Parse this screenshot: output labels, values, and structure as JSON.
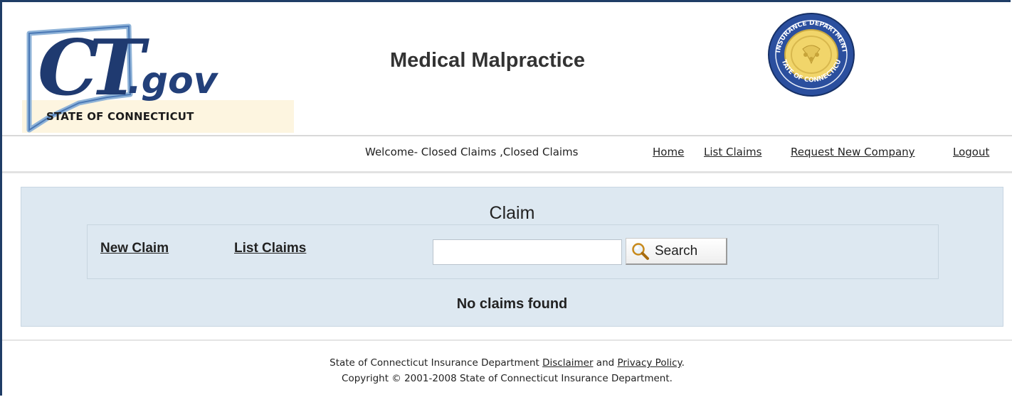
{
  "header": {
    "logo": {
      "text": "CT.gov",
      "subtitle": "STATE OF CONNECTICUT"
    },
    "app_title": "Medical Malpractice",
    "seal": {
      "icon": "state-seal-icon",
      "text": "INSURANCE DEPARTMENT · STATE OF CONNECTICUT"
    }
  },
  "nav": {
    "welcome": "Welcome- Closed Claims ,Closed Claims",
    "links": {
      "home": "Home",
      "list_claims": "List Claims",
      "request_new_company": "Request New Company",
      "logout": "Logout"
    }
  },
  "main": {
    "title": "Claim",
    "new_claim": "New Claim",
    "list_claims": "List Claims",
    "search": {
      "value": "",
      "placeholder": "",
      "button_label": "Search",
      "button_icon": "magnifier-icon"
    },
    "status": "No claims found"
  },
  "footer": {
    "line1_prefix": "State of Connecticut Insurance Department ",
    "disclaimer": "Disclaimer",
    "and": " and ",
    "privacy": "Privacy Policy",
    "period": ".",
    "copyright": "Copyright © 2001-2008 State of Connecticut Insurance Department."
  },
  "colors": {
    "frame": "#1f3d66",
    "panel": "#dde8f1",
    "logo_blue": "#23407a",
    "seal_blue": "#2b4f9e",
    "seal_gold": "#f1d56a"
  }
}
